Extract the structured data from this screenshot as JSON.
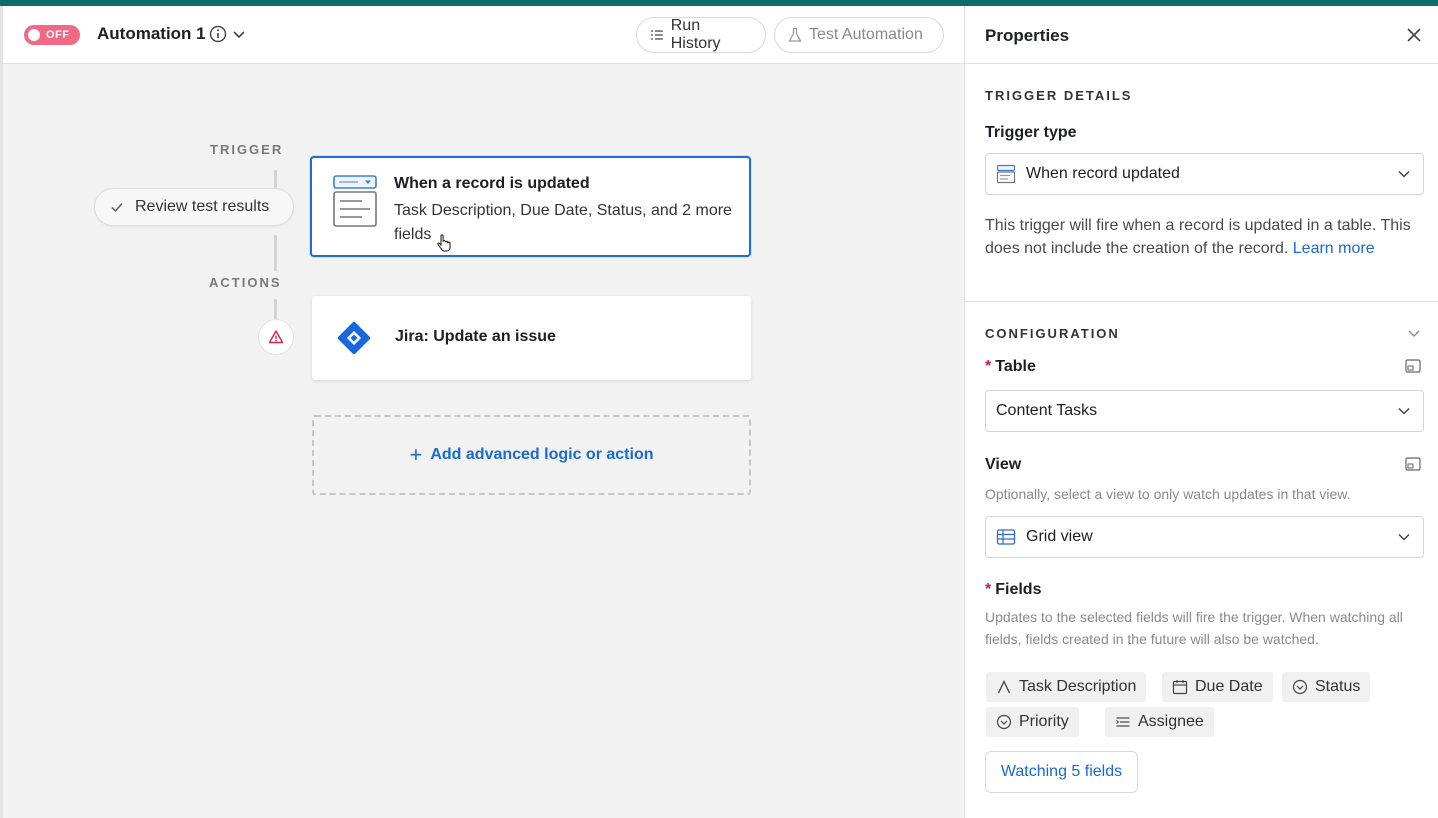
{
  "header": {
    "toggle_label": "OFF",
    "automation_name": "Automation 1",
    "run_history_label": "Run History",
    "test_automation_label": "Test Automation"
  },
  "flow": {
    "trigger_label": "TRIGGER",
    "actions_label": "ACTIONS",
    "review_label": "Review test results",
    "trigger_card": {
      "title": "When a record is updated",
      "description": "Task Description, Due Date, Status, and 2 more fields"
    },
    "action_card": {
      "title": "Jira: Update an issue"
    },
    "add_label": "Add advanced logic or action"
  },
  "panel": {
    "title": "Properties",
    "trigger_details": {
      "section_title": "TRIGGER DETAILS",
      "trigger_type_label": "Trigger type",
      "trigger_type_value": "When record updated",
      "help_text": "This trigger will fire when a record is updated in a table. This does not include the creation of the record.",
      "learn_more": "Learn more"
    },
    "configuration": {
      "section_title": "CONFIGURATION",
      "table_label": "Table",
      "table_value": "Content Tasks",
      "view_label": "View",
      "view_help": "Optionally, select a view to only watch updates in that view.",
      "view_value": "Grid view",
      "fields_label": "Fields",
      "fields_help": "Updates to the selected fields will fire the trigger. When watching all fields, fields created in the future will also be watched.",
      "fields": [
        {
          "label": "Task Description",
          "icon": "text-icon"
        },
        {
          "label": "Due Date",
          "icon": "calendar-icon"
        },
        {
          "label": "Status",
          "icon": "single-select-icon"
        },
        {
          "label": "Priority",
          "icon": "single-select-icon"
        },
        {
          "label": "Assignee",
          "icon": "multi-select-icon"
        }
      ],
      "watching_label": "Watching 5 fields"
    }
  },
  "colors": {
    "accent": "#1a6ad0",
    "toggle_off": "#f06a85",
    "warning": "#d3244a",
    "jira": "#1868db"
  }
}
